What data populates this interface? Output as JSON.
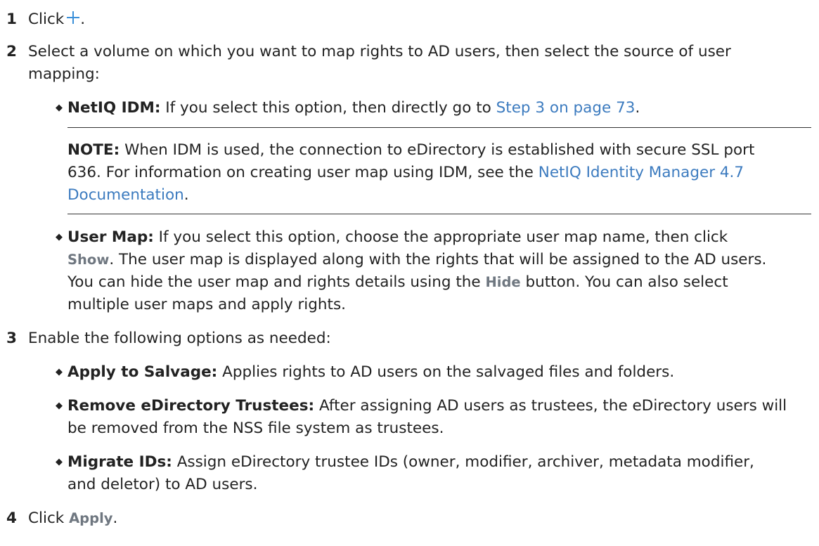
{
  "steps": {
    "s1": {
      "num": "1",
      "text": "Click",
      "icon": "plus-icon",
      "after": "."
    },
    "s2": {
      "num": "2",
      "line1": "Select a volume on which you want to map rights to AD users, then select the source of user",
      "line2": "mapping:",
      "idm": {
        "label": "NetIQ IDM:",
        "text": " If you select this option, then directly go to ",
        "link": "Step 3 on page 73",
        "after": "."
      },
      "note": {
        "label": "NOTE:",
        "line1": " When IDM is used, the connection to eDirectory is established with secure SSL port",
        "line2": "636. For information on creating user map using IDM, see the ",
        "link1": "NetIQ Identity Manager 4.7",
        "link2": "Documentation",
        "after": "."
      },
      "usermap": {
        "label": "User Map:",
        "line1": " If you select this option, choose the appropriate user map name, then click",
        "show": "Show",
        "line2": ". The user map is displayed along with the rights that will be assigned to the AD users.",
        "line3a": "You can hide the user map and rights details using the ",
        "hide": "Hide",
        "line3b": " button. You can also select",
        "line4": "multiple user maps and apply rights."
      }
    },
    "s3": {
      "num": "3",
      "text": "Enable the following options as needed:",
      "salvage": {
        "label": "Apply to Salvage:",
        "text": " Applies rights to AD users on the salvaged files and folders."
      },
      "remove": {
        "label": "Remove eDirectory Trustees:",
        "line1": " After assigning AD users as trustees, the eDirectory users will",
        "line2": "be removed from the NSS file system as trustees."
      },
      "migrate": {
        "label": "Migrate IDs:",
        "line1": " Assign eDirectory trustee IDs (owner, modifier, archiver, metadata modifier,",
        "line2": "and deletor) to AD users."
      }
    },
    "s4": {
      "num": "4",
      "text": "Click ",
      "apply": "Apply",
      "after": "."
    }
  },
  "colors": {
    "link": "#3c7bbf",
    "icon": "#3a8fd9",
    "ui_label": "#6f7780"
  }
}
